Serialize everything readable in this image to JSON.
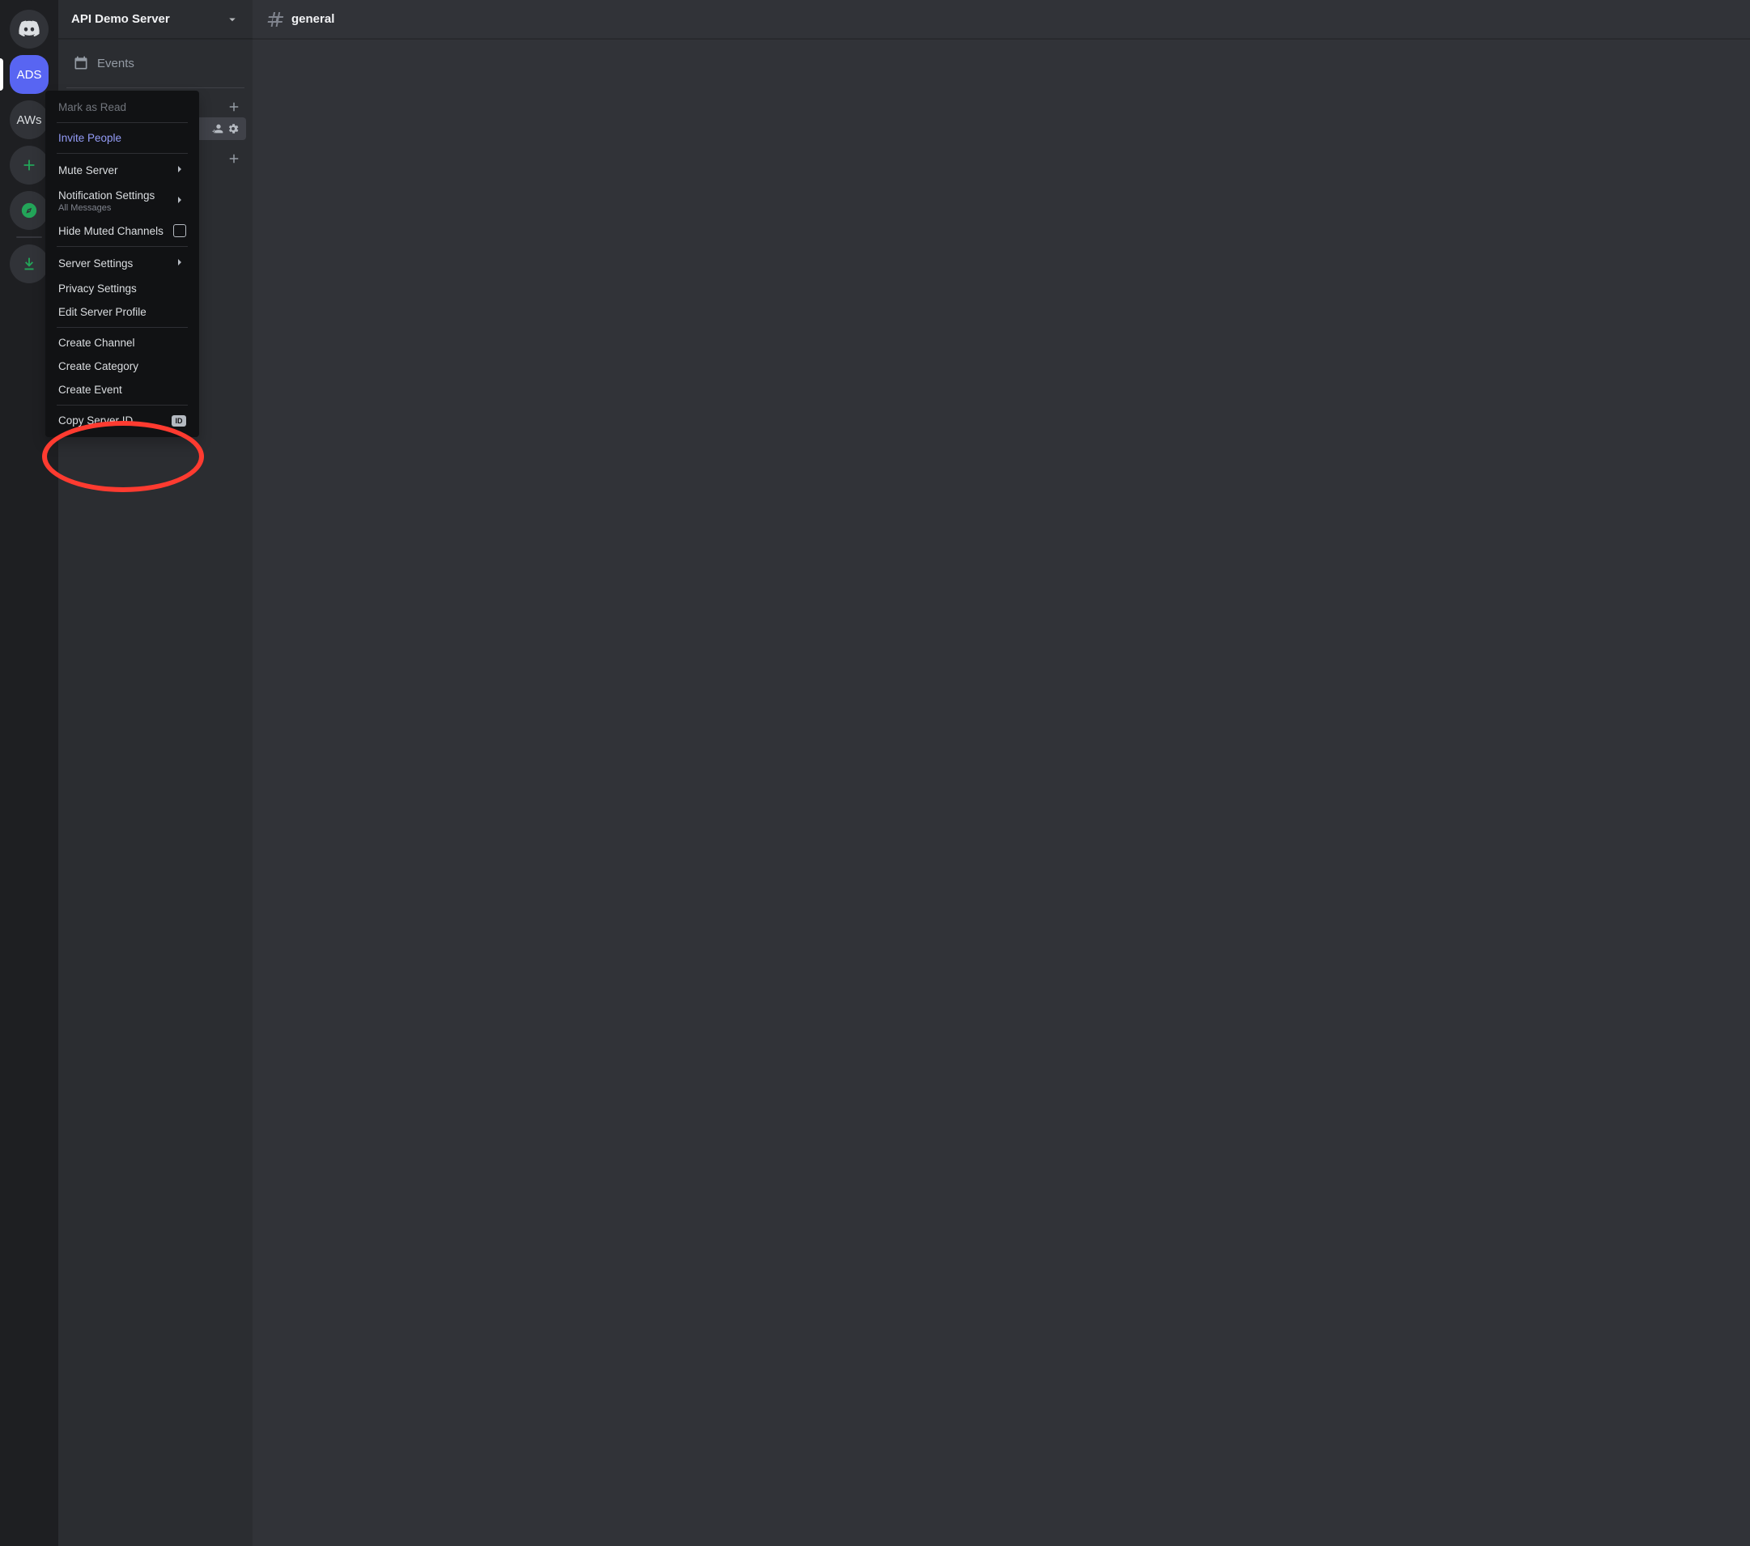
{
  "server_rail": {
    "home_label": "Home",
    "servers": [
      {
        "abbr": "ADS",
        "selected": true
      },
      {
        "abbr": "AWs",
        "selected": false
      }
    ],
    "add_label": "Add a Server",
    "explore_label": "Explore",
    "download_label": "Download Apps"
  },
  "sidebar": {
    "server_name": "API Demo Server",
    "events_label": "Events",
    "categories": [
      {
        "add_icon": "+"
      }
    ],
    "selected_channel_actions": [
      "invite",
      "settings"
    ],
    "categories2": [
      {
        "add_icon": "+"
      }
    ]
  },
  "main": {
    "channel_name": "general"
  },
  "context_menu": {
    "mark_as_read": "Mark as Read",
    "invite_people": "Invite People",
    "mute_server": "Mute Server",
    "notification_settings": "Notification Settings",
    "notification_sub": "All Messages",
    "hide_muted": "Hide Muted Channels",
    "server_settings": "Server Settings",
    "privacy_settings": "Privacy Settings",
    "edit_server_profile": "Edit Server Profile",
    "create_channel": "Create Channel",
    "create_category": "Create Category",
    "create_event": "Create Event",
    "copy_server_id": "Copy Server ID"
  },
  "annotation": {
    "highlight_target": "copy-server-id"
  }
}
